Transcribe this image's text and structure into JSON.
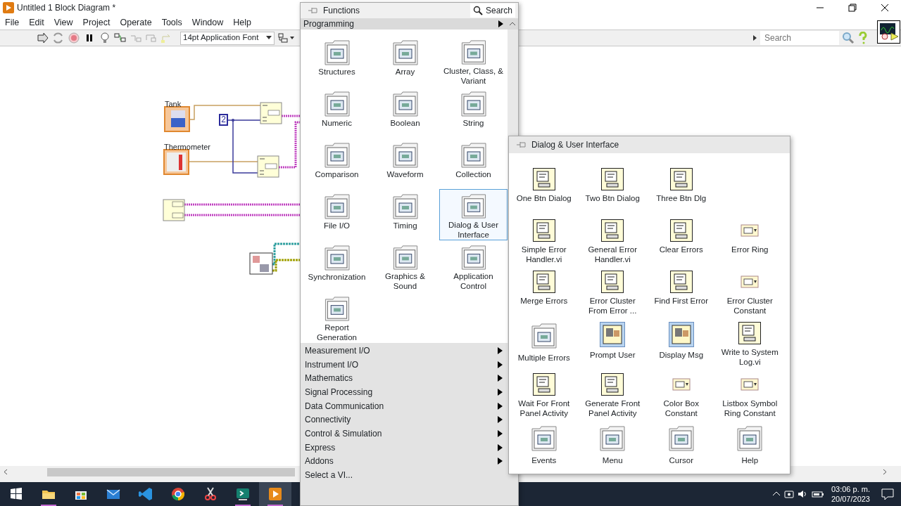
{
  "window": {
    "title": "Untitled 1 Block Diagram *",
    "menu": [
      "File",
      "Edit",
      "View",
      "Project",
      "Operate",
      "Tools",
      "Window",
      "Help"
    ]
  },
  "toolbar": {
    "font": "14pt Application Font",
    "search_placeholder": "Search"
  },
  "diagram": {
    "labels": [
      "Tank",
      "Thermometer"
    ],
    "constant": "2"
  },
  "palette": {
    "title": "Functions",
    "search_button": "Search",
    "category": "Programming",
    "items": [
      {
        "label": "Structures",
        "selected": false
      },
      {
        "label": "Array",
        "selected": false
      },
      {
        "label": "Cluster, Class, & Variant",
        "selected": false
      },
      {
        "label": "Numeric",
        "selected": false
      },
      {
        "label": "Boolean",
        "selected": false
      },
      {
        "label": "String",
        "selected": false
      },
      {
        "label": "Comparison",
        "selected": false
      },
      {
        "label": "Waveform",
        "selected": false
      },
      {
        "label": "Collection",
        "selected": false
      },
      {
        "label": "File I/O",
        "selected": false
      },
      {
        "label": "Timing",
        "selected": false
      },
      {
        "label": "Dialog & User Interface",
        "selected": true
      },
      {
        "label": "Synchronization",
        "selected": false
      },
      {
        "label": "Graphics & Sound",
        "selected": false
      },
      {
        "label": "Application Control",
        "selected": false
      },
      {
        "label": "Report Generation",
        "selected": false
      }
    ],
    "categories": [
      {
        "label": "Measurement I/O",
        "submenu": true
      },
      {
        "label": "Instrument I/O",
        "submenu": true
      },
      {
        "label": "Mathematics",
        "submenu": true
      },
      {
        "label": "Signal Processing",
        "submenu": true
      },
      {
        "label": "Data Communication",
        "submenu": true
      },
      {
        "label": "Connectivity",
        "submenu": true
      },
      {
        "label": "Control & Simulation",
        "submenu": true
      },
      {
        "label": "Express",
        "submenu": true
      },
      {
        "label": "Addons",
        "submenu": true
      },
      {
        "label": "Select a VI...",
        "submenu": false
      }
    ]
  },
  "submenu": {
    "title": "Dialog & User Interface",
    "rows": [
      [
        {
          "label": "One Btn Dialog",
          "kind": "vi"
        },
        {
          "label": "Two Btn Dialog",
          "kind": "vi"
        },
        {
          "label": "Three Btn Dlg",
          "kind": "vi"
        }
      ],
      [
        {
          "label": "Simple Error Handler.vi",
          "kind": "vi"
        },
        {
          "label": "General Error Handler.vi",
          "kind": "vi"
        },
        {
          "label": "Clear Errors",
          "kind": "vi"
        },
        {
          "label": "Error Ring",
          "kind": "constant"
        }
      ],
      [
        {
          "label": "Merge Errors",
          "kind": "vi"
        },
        {
          "label": "Error Cluster From Error ...",
          "kind": "vi"
        },
        {
          "label": "Find First Error",
          "kind": "vi"
        },
        {
          "label": "Error Cluster Constant",
          "kind": "constant"
        }
      ],
      [
        {
          "label": "Multiple Errors",
          "kind": "folder"
        },
        {
          "label": "Prompt User",
          "kind": "express"
        },
        {
          "label": "Display Msg",
          "kind": "express"
        },
        {
          "label": "Write to System Log.vi",
          "kind": "vi"
        }
      ],
      [
        {
          "label": "Wait For Front Panel Activity",
          "kind": "vi"
        },
        {
          "label": "Generate Front Panel Activity",
          "kind": "vi"
        },
        {
          "label": "Color Box Constant",
          "kind": "constant"
        },
        {
          "label": "Listbox Symbol Ring Constant",
          "kind": "constant"
        }
      ],
      [
        {
          "label": "Events",
          "kind": "folder"
        },
        {
          "label": "Menu",
          "kind": "folder"
        },
        {
          "label": "Cursor",
          "kind": "folder"
        },
        {
          "label": "Help",
          "kind": "folder"
        }
      ]
    ]
  },
  "taskbar": {
    "apps": [
      {
        "kind": "folder",
        "open": true,
        "active": false
      },
      {
        "kind": "bag",
        "open": false,
        "active": false
      },
      {
        "kind": "mail",
        "open": false,
        "active": false
      },
      {
        "kind": "code",
        "open": false,
        "active": false
      },
      {
        "kind": "browser",
        "open": false,
        "active": false
      },
      {
        "kind": "scissors",
        "open": false,
        "active": false
      },
      {
        "kind": "terminal",
        "open": true,
        "active": false
      },
      {
        "kind": "play",
        "open": true,
        "active": true
      }
    ],
    "time": "03:06 p. m.",
    "date": "20/07/2023"
  }
}
